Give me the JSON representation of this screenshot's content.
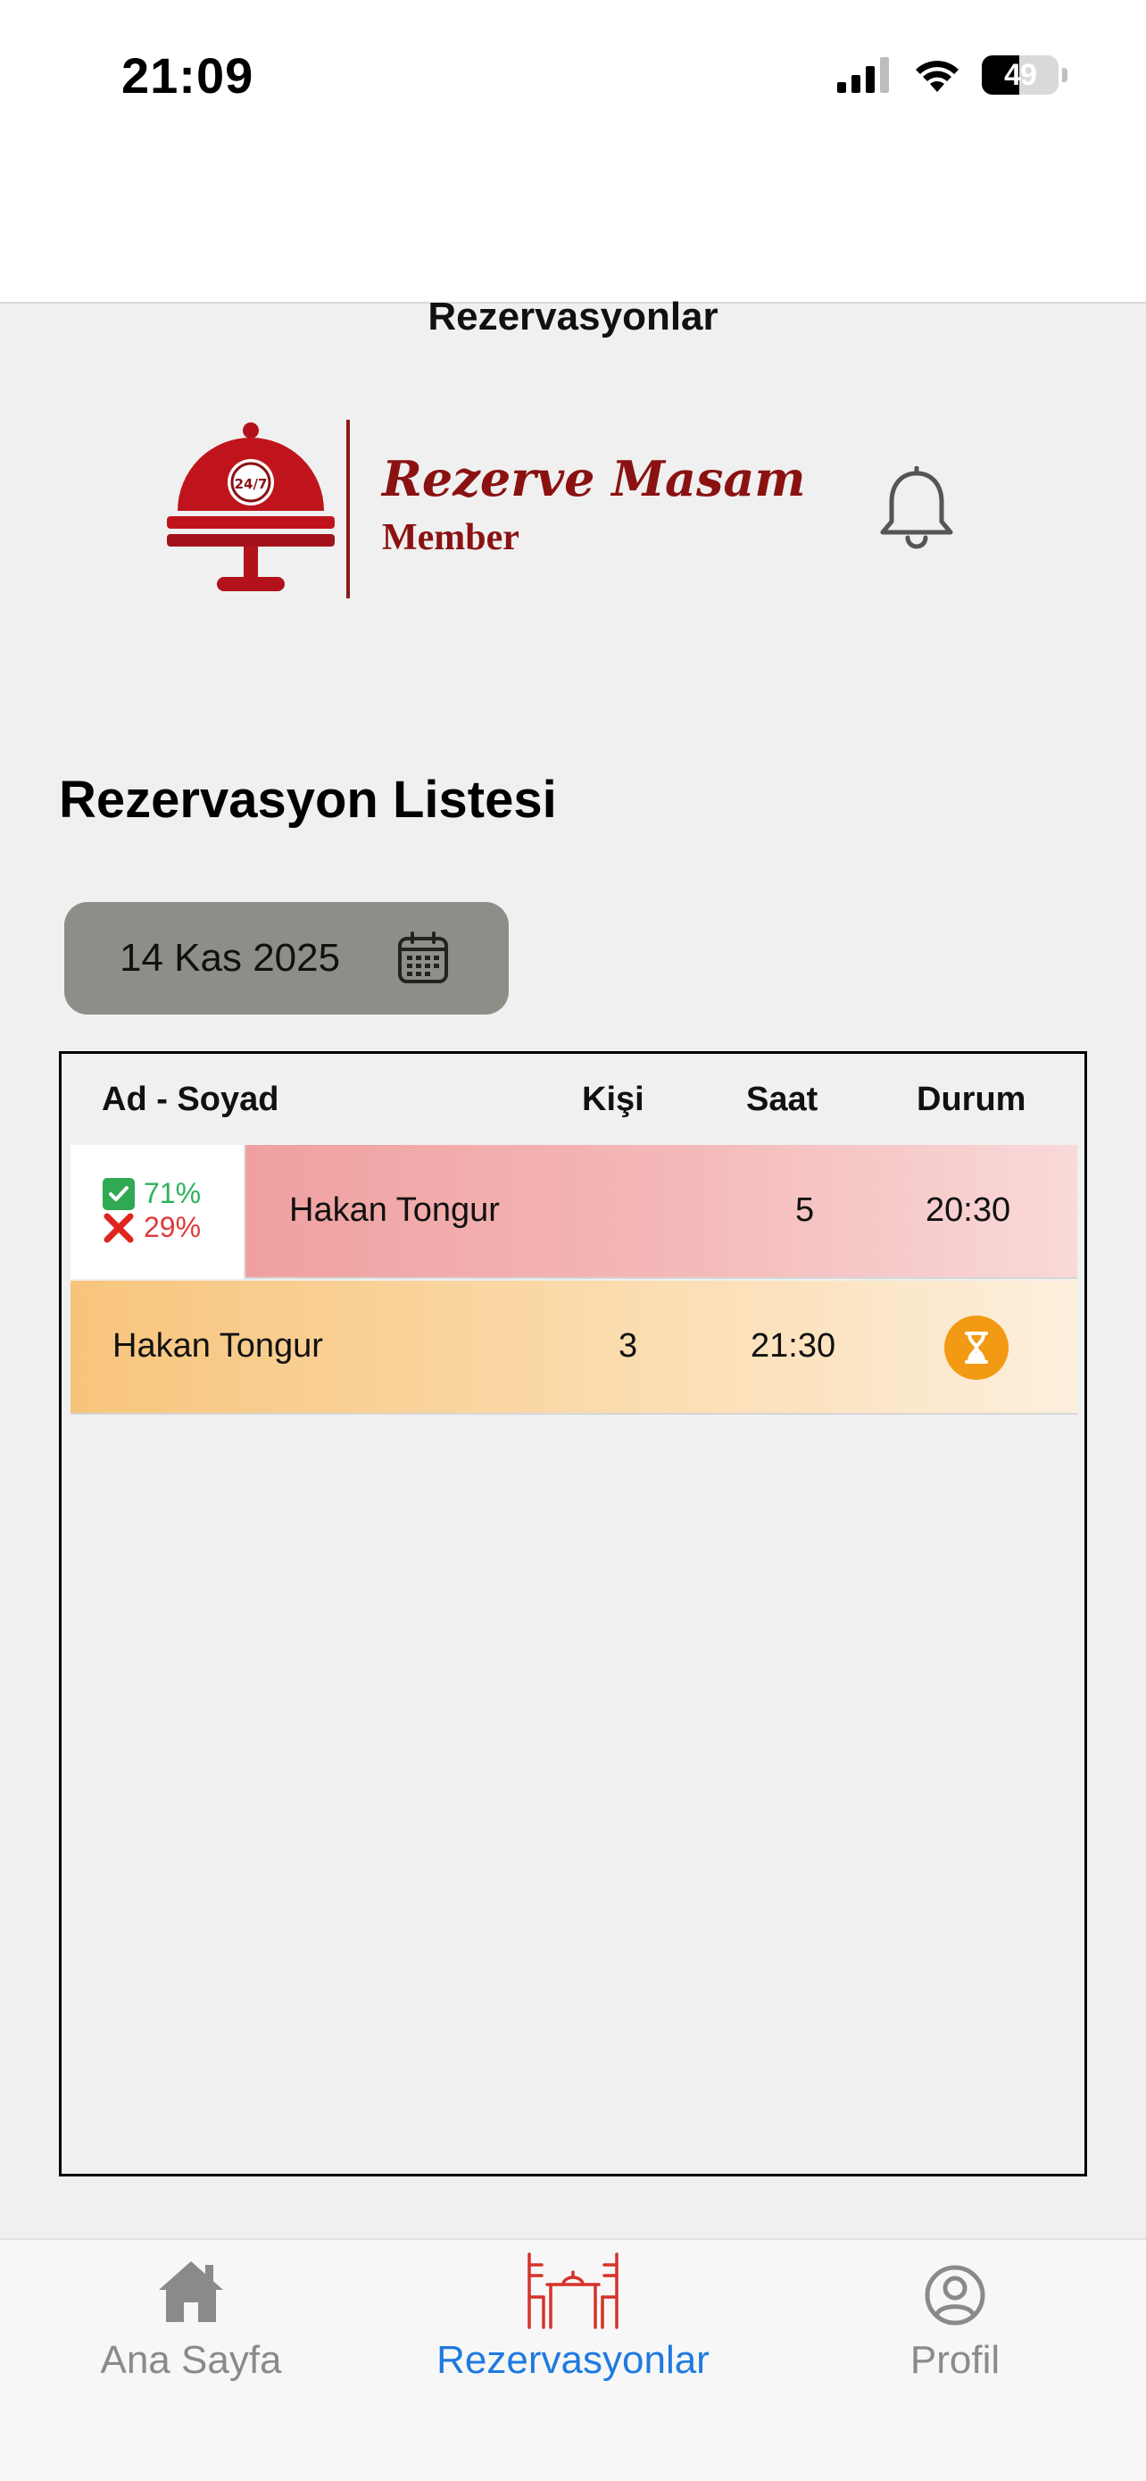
{
  "status_bar": {
    "time": "21:09",
    "battery": "49",
    "battery_level": 0.49
  },
  "header": {
    "title": "Rezervasyonlar"
  },
  "brand": {
    "name": "Rezerve Masam",
    "subtitle": "Member",
    "badge": "24/7"
  },
  "section": {
    "title": "Rezervasyon Listesi"
  },
  "date_picker": {
    "value": "14 Kas 2025"
  },
  "table": {
    "headers": {
      "name": "Ad - Soyad",
      "people": "Kişi",
      "time": "Saat",
      "status": "Durum"
    },
    "rows": [
      {
        "name": "Hakan Tongur",
        "people": "5",
        "time": "20:30",
        "stat_ok": "71%",
        "stat_no": "29%"
      },
      {
        "name": "Hakan Tongur",
        "people": "3",
        "time": "21:30",
        "status_icon": "hourglass-icon"
      }
    ]
  },
  "tabs": [
    {
      "label": "Ana Sayfa",
      "icon": "home-icon",
      "active": false
    },
    {
      "label": "Rezervasyonlar",
      "icon": "table-chairs-icon",
      "active": true
    },
    {
      "label": "Profil",
      "icon": "profile-icon",
      "active": false
    }
  ],
  "colors": {
    "accent": "#1f7ae0",
    "brand": "#8b1212",
    "row_cancelled": "#ee9696",
    "row_pending": "#f7c47c",
    "pending_badge": "#f29a13"
  }
}
